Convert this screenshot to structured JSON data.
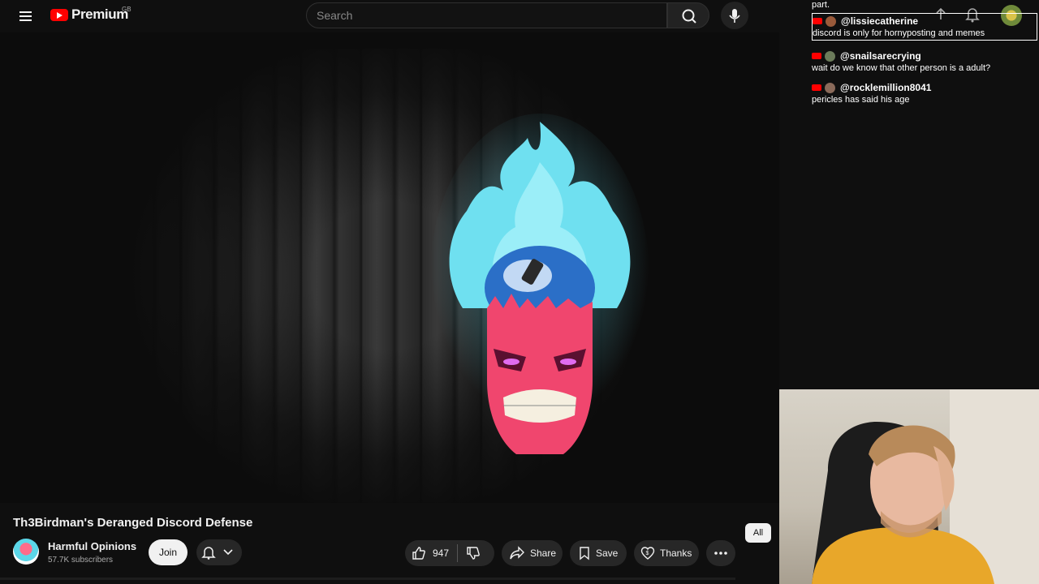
{
  "header": {
    "logo_text": "Premium",
    "region": "GB",
    "search_placeholder": "Search"
  },
  "chat": {
    "fragment": "part.",
    "messages": [
      {
        "author": "@lissiecatherine",
        "text": "discord is only for hornyposting and memes",
        "highlighted": true
      },
      {
        "author": "@snailsarecrying",
        "text": "wait do we know that other person is a adult?",
        "highlighted": false
      },
      {
        "author": "@rocklemillion8041",
        "text": "pericles has said his age",
        "highlighted": false
      }
    ]
  },
  "video": {
    "title": "Th3Birdman's Deranged Discord Defense"
  },
  "channel": {
    "name": "Harmful Opinions",
    "subscribers": "57.7K subscribers",
    "join_label": "Join"
  },
  "actions": {
    "likes": "947",
    "share_label": "Share",
    "save_label": "Save",
    "thanks_label": "Thanks"
  },
  "filter_chip": "All",
  "colors": {
    "background": "#0f0f0f",
    "brand_red": "#ff0000",
    "button_bg": "#272727",
    "flame_cyan": "#5bd6e8",
    "skull_pink": "#f0466e"
  }
}
